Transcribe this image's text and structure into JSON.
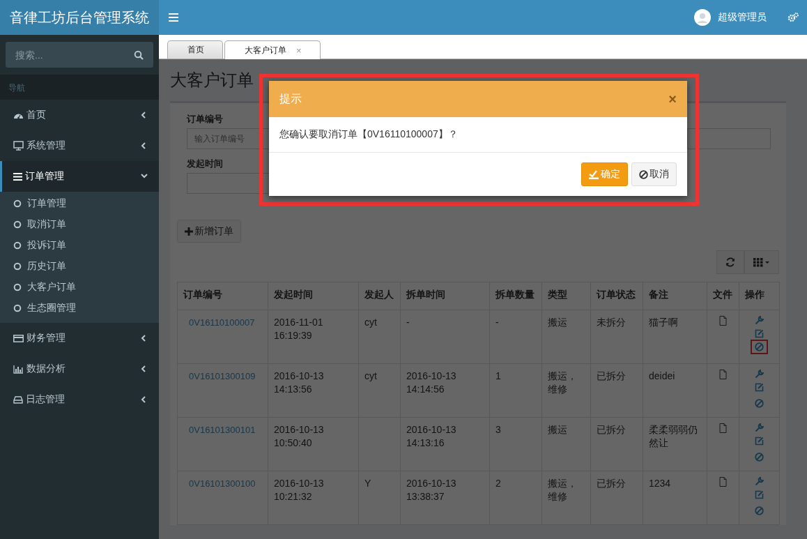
{
  "app_title": "音律工坊后台管理系统",
  "header": {
    "user_name": "超级管理员"
  },
  "sidebar": {
    "search": {
      "placeholder": "搜索..."
    },
    "section_label": "导航",
    "items": [
      {
        "label": "首页",
        "selected": false,
        "expanded": false
      },
      {
        "label": "系统管理",
        "selected": false,
        "expanded": false
      },
      {
        "label": "订单管理",
        "selected": true,
        "expanded": true,
        "children": [
          {
            "label": "订单管理"
          },
          {
            "label": "取消订单"
          },
          {
            "label": "投诉订单"
          },
          {
            "label": "历史订单"
          },
          {
            "label": "大客户订单"
          },
          {
            "label": "生态圈管理"
          }
        ]
      },
      {
        "label": "财务管理",
        "selected": false,
        "expanded": false
      },
      {
        "label": "数据分析",
        "selected": false,
        "expanded": false
      },
      {
        "label": "日志管理",
        "selected": false,
        "expanded": false
      }
    ]
  },
  "tabs": [
    {
      "label": "首页",
      "selected": false
    },
    {
      "label": "大客户订单",
      "selected": true,
      "close": "×"
    }
  ],
  "page": {
    "title": "大客户订单",
    "filters": [
      {
        "kind": "text",
        "label": "订单编号",
        "placeholder": "输入订单编号"
      },
      {
        "kind": "text"
      },
      {
        "kind": "text",
        "label": "发起时间"
      }
    ],
    "add_button": "新增订单",
    "table": {
      "columns": [
        "订单编号",
        "发起时间",
        "发起人",
        "拆单时间",
        "拆单数量",
        "类型",
        "订单状态",
        "备注",
        "文件",
        "操作"
      ],
      "rows": [
        {
          "order_no": "0V16110100007",
          "start_time": "2016-11-01 16:19:39",
          "initiator": "cyt",
          "split_time": "-",
          "split_count": "-",
          "type": "搬运",
          "status": "未拆分",
          "remark": "猫子啊",
          "highlighted_action": true
        },
        {
          "order_no": "0V16101300109",
          "start_time": "2016-10-13 14:13:56",
          "initiator": "cyt",
          "split_time": "2016-10-13 14:14:56",
          "split_count": "1",
          "type": "搬运，维修",
          "status": "已拆分",
          "remark": "deidei",
          "highlighted_action": false
        },
        {
          "order_no": "0V16101300101",
          "start_time": "2016-10-13 10:50:40",
          "split_time": "2016-10-13 14:13:16",
          "split_count": "3",
          "type": "搬运",
          "status": "已拆分",
          "remark": "柔柔弱弱仍然让",
          "highlighted_action": false
        },
        {
          "order_no": "0V16101300100",
          "start_time": "2016-10-13 10:21:32",
          "initiator": "Y",
          "split_time": "2016-10-13 13:38:37",
          "split_count": "2",
          "type": "搬运，维修",
          "status": "已拆分",
          "remark": "1234",
          "highlighted_action": false
        }
      ]
    }
  },
  "modal": {
    "title": "提示",
    "close": "×",
    "message": "您确认要取消订单【0V16110100007】？",
    "buttons": [
      {
        "kind": "primary",
        "label": "确定"
      },
      {
        "kind": "default",
        "label": "取消"
      }
    ]
  }
}
